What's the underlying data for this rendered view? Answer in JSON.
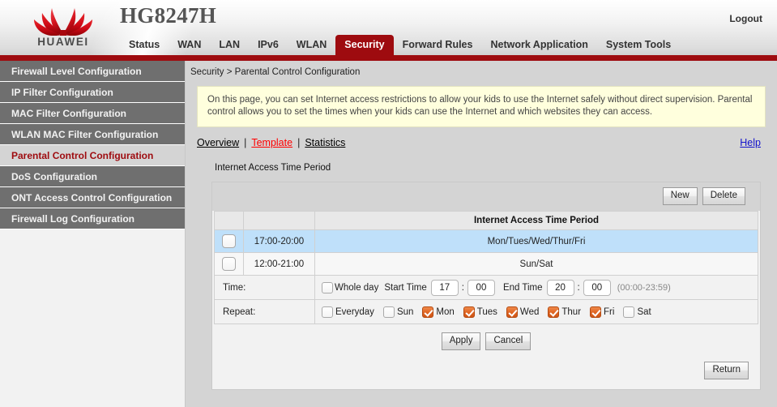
{
  "header": {
    "brand": "HUAWEI",
    "model": "HG8247H",
    "logout_label": "Logout",
    "accent_red": "#9e0b0f",
    "nav": [
      {
        "label": "Status",
        "active": false
      },
      {
        "label": "WAN",
        "active": false
      },
      {
        "label": "LAN",
        "active": false
      },
      {
        "label": "IPv6",
        "active": false
      },
      {
        "label": "WLAN",
        "active": false
      },
      {
        "label": "Security",
        "active": true
      },
      {
        "label": "Forward Rules",
        "active": false
      },
      {
        "label": "Network Application",
        "active": false
      },
      {
        "label": "System Tools",
        "active": false
      }
    ]
  },
  "sidebar": {
    "items": [
      {
        "label": "Firewall Level Configuration",
        "selected": false
      },
      {
        "label": "IP Filter Configuration",
        "selected": false
      },
      {
        "label": "MAC Filter Configuration",
        "selected": false
      },
      {
        "label": "WLAN MAC Filter Configuration",
        "selected": false
      },
      {
        "label": "Parental Control Configuration",
        "selected": true
      },
      {
        "label": "DoS Configuration",
        "selected": false
      },
      {
        "label": "ONT Access Control Configuration",
        "selected": false
      },
      {
        "label": "Firewall Log Configuration",
        "selected": false
      }
    ]
  },
  "main": {
    "breadcrumb": "Security > Parental Control Configuration",
    "info_text": "On this page, you can set Internet access restrictions to allow your kids to use the Internet safely without direct supervision. Parental control allows you to set the times when your kids can use the Internet and which websites they can access.",
    "tabs": [
      {
        "label": "Overview",
        "active": false
      },
      {
        "label": "Template",
        "active": true
      },
      {
        "label": "Statistics",
        "active": false
      }
    ],
    "tab_separator": "|",
    "help_label": "Help",
    "section_label": "Internet Access Time Period",
    "toolbar": {
      "new_label": "New",
      "delete_label": "Delete"
    },
    "table": {
      "headers": [
        "",
        "",
        "Internet Access Time Period"
      ],
      "rows": [
        {
          "checked": false,
          "selected": true,
          "time": "17:00-20:00",
          "period": "Mon/Tues/Wed/Thur/Fri"
        },
        {
          "checked": false,
          "selected": false,
          "time": "12:00-21:00",
          "period": "Sun/Sat"
        }
      ]
    },
    "time_form": {
      "label": "Time:",
      "whole_day_label": "Whole day",
      "whole_day_checked": false,
      "start_label": "Start Time",
      "start_hour": "17",
      "start_minute": "00",
      "end_label": "End Time",
      "end_hour": "20",
      "end_minute": "00",
      "colon": ":",
      "range_hint": "(00:00-23:59)"
    },
    "repeat_form": {
      "label": "Repeat:",
      "days": [
        {
          "label": "Everyday",
          "checked": false
        },
        {
          "label": "Sun",
          "checked": false
        },
        {
          "label": "Mon",
          "checked": true
        },
        {
          "label": "Tues",
          "checked": true
        },
        {
          "label": "Wed",
          "checked": true
        },
        {
          "label": "Thur",
          "checked": true
        },
        {
          "label": "Fri",
          "checked": true
        },
        {
          "label": "Sat",
          "checked": false
        }
      ],
      "checked_color": "#de6321"
    },
    "actions": {
      "apply_label": "Apply",
      "cancel_label": "Cancel",
      "return_label": "Return"
    }
  }
}
